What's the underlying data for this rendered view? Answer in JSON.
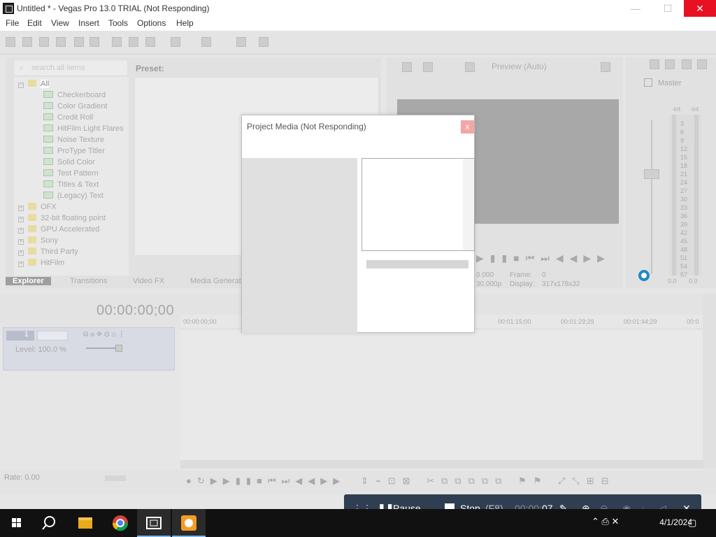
{
  "window": {
    "title": "Untitled * - Vegas Pro 13.0 TRIAL (Not Responding)",
    "minimize": "—",
    "maximize": "☐",
    "close": "✕"
  },
  "menu": [
    "File",
    "Edit",
    "View",
    "Insert",
    "Tools",
    "Options",
    "Help"
  ],
  "explorer": {
    "search_placeholder": "search all items",
    "preset_label": "Preset:",
    "tree": [
      {
        "label": "All",
        "kind": "folder-open"
      },
      {
        "label": "Checkerboard",
        "kind": "generator"
      },
      {
        "label": "Color Gradient",
        "kind": "generator"
      },
      {
        "label": "Credit Roll",
        "kind": "generator"
      },
      {
        "label": "HitFilm Light Flares",
        "kind": "generator"
      },
      {
        "label": "Noise Texture",
        "kind": "generator"
      },
      {
        "label": "ProType Titler",
        "kind": "generator"
      },
      {
        "label": "Solid Color",
        "kind": "generator"
      },
      {
        "label": "Test Pattern",
        "kind": "generator"
      },
      {
        "label": "Titles & Text",
        "kind": "generator"
      },
      {
        "label": "(Legacy) Text",
        "kind": "generator"
      },
      {
        "label": "OFX",
        "kind": "folder"
      },
      {
        "label": "32-bit floating point",
        "kind": "folder"
      },
      {
        "label": "GPU Accelerated",
        "kind": "folder"
      },
      {
        "label": "Sony",
        "kind": "folder"
      },
      {
        "label": "Third Party",
        "kind": "folder"
      },
      {
        "label": "HitFilm",
        "kind": "folder"
      }
    ],
    "tabs": [
      "Explorer",
      "Transitions",
      "Video FX",
      "Media Generat"
    ]
  },
  "preview": {
    "mode": "Preview (Auto)",
    "project_label": "30.000p",
    "frame_label": "Frame:",
    "frame_value": "0",
    "display_label": "Display:",
    "display_value": "317x178x32",
    "extra": "0.000"
  },
  "master": {
    "label": "Master",
    "inf_left": "-Inf.",
    "inf_right": "-Inf.",
    "scale": [
      "3",
      "6",
      "9",
      "12",
      "15",
      "18",
      "21",
      "24",
      "27",
      "30",
      "33",
      "36",
      "39",
      "42",
      "45",
      "48",
      "51",
      "54",
      "57"
    ],
    "value_left": "0.0",
    "value_right": "0.0"
  },
  "timeline": {
    "timecode": "00:00:00;00",
    "track_number": "1",
    "level": "Level: 100.0 %",
    "rate": "Rate: 0.00",
    "ruler": [
      "00:00:00;00",
      "00:01:15;00",
      "00:01:29;29",
      "00:01:44;29",
      "00:0"
    ]
  },
  "dialog": {
    "title": "Project Media (Not Responding)",
    "close": "x"
  },
  "recorder": {
    "pause_label": "Pause",
    "stop_label": "Stop",
    "stop_shortcut": "(F8)",
    "time_dim": "00:00:",
    "time_bright": "07"
  },
  "taskbar": {
    "date": "4/1/2024"
  }
}
